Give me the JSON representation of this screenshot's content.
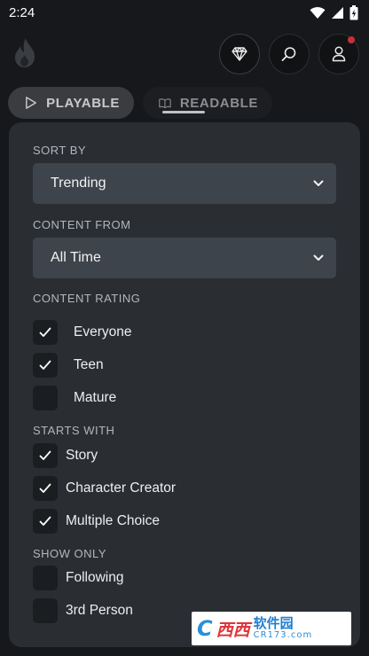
{
  "status_bar": {
    "time": "2:24"
  },
  "tabs": [
    {
      "label": "PLAYABLE",
      "icon": "play-icon",
      "selected": true
    },
    {
      "label": "READABLE",
      "icon": "book-icon",
      "selected": false
    }
  ],
  "filters": {
    "sort_by": {
      "label": "SORT BY",
      "value": "Trending"
    },
    "content_from": {
      "label": "CONTENT FROM",
      "value": "All Time"
    },
    "content_rating": {
      "label": "CONTENT RATING",
      "options": [
        {
          "label": "Everyone",
          "checked": true
        },
        {
          "label": "Teen",
          "checked": true
        },
        {
          "label": "Mature",
          "checked": false
        }
      ]
    },
    "starts_with": {
      "label": "STARTS WITH",
      "options": [
        {
          "label": "Story",
          "checked": true
        },
        {
          "label": "Character Creator",
          "checked": true
        },
        {
          "label": "Multiple Choice",
          "checked": true
        }
      ]
    },
    "show_only": {
      "label": "SHOW ONLY",
      "options": [
        {
          "label": "Following",
          "checked": false
        },
        {
          "label": "3rd Person",
          "checked": false
        }
      ]
    }
  },
  "watermark": {
    "mark": "C",
    "red": "西西",
    "cn": "软件园",
    "url": "CR173.com"
  },
  "colors": {
    "background": "#16181b",
    "panel": "#2a2e33",
    "select": "#3e444b",
    "checkbox": "#1b1e21",
    "notification": "#c6303a"
  }
}
